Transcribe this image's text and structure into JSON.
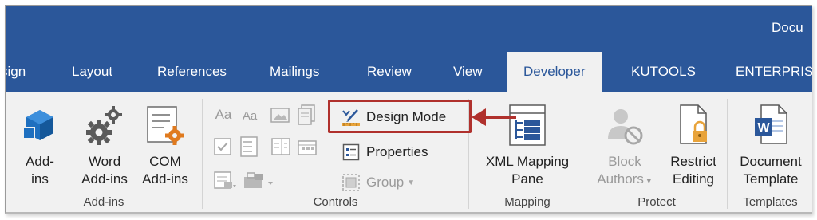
{
  "window": {
    "doc_title": "Docu"
  },
  "tabs": [
    {
      "label": "sign"
    },
    {
      "label": "Layout"
    },
    {
      "label": "References"
    },
    {
      "label": "Mailings"
    },
    {
      "label": "Review"
    },
    {
      "label": "View"
    },
    {
      "label": "Developer",
      "active": true
    },
    {
      "label": "KUTOOLS"
    },
    {
      "label": "ENTERPRIS"
    }
  ],
  "groups": {
    "addins": {
      "label": "Add-ins",
      "buttons": [
        {
          "line1": "Add-",
          "line2": "ins",
          "icon": "addins-cube-icon"
        },
        {
          "line1": "Word",
          "line2": "Add-ins",
          "icon": "gears-icon"
        },
        {
          "line1": "COM",
          "line2": "Add-ins",
          "icon": "com-addins-icon"
        }
      ]
    },
    "controls": {
      "label": "Controls",
      "design_mode": "Design Mode",
      "properties": "Properties",
      "group": "Group",
      "small_icons": [
        "Aa",
        "Aa"
      ]
    },
    "mapping": {
      "label": "Mapping",
      "xml_line1": "XML Mapping",
      "xml_line2": "Pane"
    },
    "protect": {
      "label": "Protect",
      "block_line1": "Block",
      "block_line2": "Authors",
      "restrict_line1": "Restrict",
      "restrict_line2": "Editing"
    },
    "templates": {
      "label": "Templates",
      "doc_line1": "Document",
      "doc_line2": "Template"
    }
  },
  "colors": {
    "ribbon_blue": "#2b579a",
    "highlight_red": "#b0312d",
    "ribbon_bg": "#f1f1f1"
  }
}
